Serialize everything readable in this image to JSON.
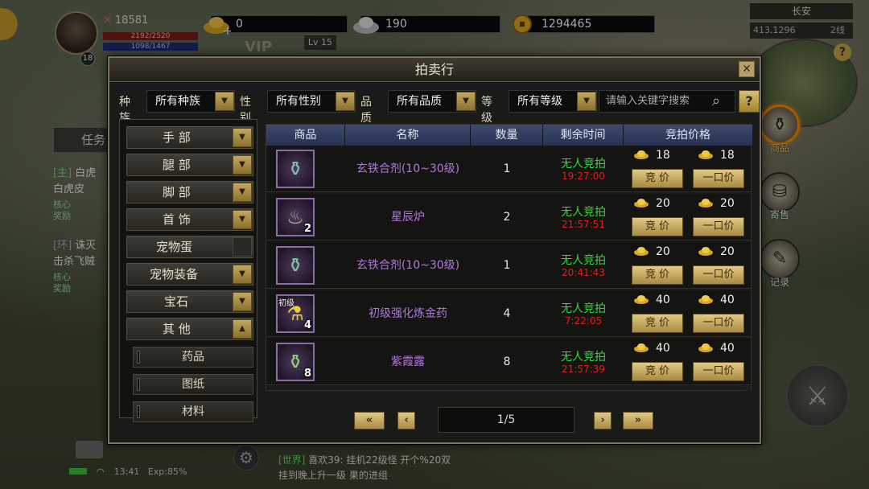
{
  "hud": {
    "power": "18581",
    "hp": "2192/2520",
    "mp": "1098/1467",
    "player_level": "18",
    "gold_ingot": "0",
    "silver_ingot": "190",
    "coins": "1294465",
    "lv_badge": "Lv 15",
    "vip": "VIP"
  },
  "map": {
    "name": "长安",
    "coords": "413,1296",
    "line": "2线"
  },
  "side_buttons": [
    {
      "label": "商品",
      "icon": "goods-icon",
      "active": true
    },
    {
      "label": "寄售",
      "icon": "consign-icon",
      "active": false
    },
    {
      "label": "记录",
      "icon": "record-icon",
      "active": false
    }
  ],
  "quest_panel": {
    "tab": "任务",
    "quests": [
      {
        "tag": "[主]",
        "title": "白虎",
        "desc": "白虎皮",
        "reward": "核心奖励"
      },
      {
        "tag": "[环]",
        "title": "诛灭",
        "desc": "击杀飞贼",
        "reward": "核心奖励"
      }
    ]
  },
  "status_bar": {
    "time": "13:41",
    "exp": "Exp:85%"
  },
  "chat": {
    "line1_channel": "[世界]",
    "line1_text": "喜欢39:  挂机22级怪 开个%20双",
    "line2_text": "挂到晚上升一级 果的进组"
  },
  "auction": {
    "title": "拍卖行",
    "close": "✕",
    "filters": [
      {
        "label": "种族",
        "value": "所有种族"
      },
      {
        "label": "性别",
        "value": "所有性别"
      },
      {
        "label": "品质",
        "value": "所有品质"
      },
      {
        "label": "等级",
        "value": "所有等级"
      }
    ],
    "search_placeholder": "请输入关键字搜索",
    "help": "?",
    "categories": [
      {
        "label": "手 部",
        "arrow": "▼"
      },
      {
        "label": "腿 部",
        "arrow": "▼"
      },
      {
        "label": "脚 部",
        "arrow": "▼"
      },
      {
        "label": "首 饰",
        "arrow": "▼"
      },
      {
        "label": "宠物蛋",
        "arrow": ""
      },
      {
        "label": "宠物装备",
        "arrow": "▼"
      },
      {
        "label": "宝石",
        "arrow": "▼"
      },
      {
        "label": "其 他",
        "arrow": "▲"
      }
    ],
    "subcategories": [
      "药品",
      "图纸",
      "材料"
    ],
    "columns": [
      "商品",
      "名称",
      "数量",
      "剩余时间",
      "竞拍价格"
    ],
    "rows": [
      {
        "name": "玄铁合剂(10~30级)",
        "count": "1",
        "status": "无人竞拍",
        "time": "19:27:00",
        "bid": "18",
        "buyout": "18",
        "qty_badge": "",
        "lvl_tag": "",
        "glyph": "⚱",
        "glyph_color": "#7fc4a8"
      },
      {
        "name": "星辰炉",
        "count": "2",
        "status": "无人竞拍",
        "time": "21:57:51",
        "bid": "20",
        "buyout": "20",
        "qty_badge": "2",
        "lvl_tag": "",
        "glyph": "♨",
        "glyph_color": "#c9b07a"
      },
      {
        "name": "玄铁合剂(10~30级)",
        "count": "1",
        "status": "无人竞拍",
        "time": "20:41:43",
        "bid": "20",
        "buyout": "20",
        "qty_badge": "",
        "lvl_tag": "",
        "glyph": "⚱",
        "glyph_color": "#7fc4a8"
      },
      {
        "name": "初级强化炼金药",
        "count": "4",
        "status": "无人竞拍",
        "time": "7:22:05",
        "bid": "40",
        "buyout": "40",
        "qty_badge": "4",
        "lvl_tag": "初级",
        "glyph": "⚗",
        "glyph_color": "#e8d23a"
      },
      {
        "name": "紫霞露",
        "count": "8",
        "status": "无人竞拍",
        "time": "21:57:39",
        "bid": "40",
        "buyout": "40",
        "qty_badge": "8",
        "lvl_tag": "",
        "glyph": "⚱",
        "glyph_color": "#8fd07a"
      }
    ],
    "bid_button": "竞 价",
    "buyout_button": "一口价",
    "pagination": {
      "first": "«",
      "prev": "‹",
      "page": "1/5",
      "next": "›",
      "last": "»"
    }
  },
  "colors": {
    "name_purple": "#b07ad8",
    "status_green": "#39d839",
    "time_red": "#e01f1f",
    "header_blue": "#3d4a6e",
    "gold_button": "#e3c983"
  }
}
